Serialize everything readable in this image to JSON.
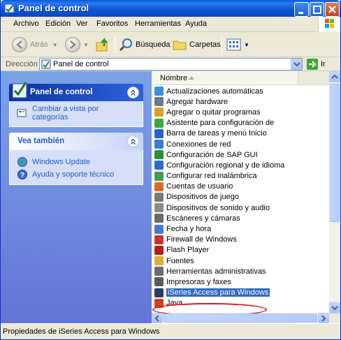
{
  "window": {
    "title": "Panel de control",
    "colors": {
      "titlebar": "#0b58d6",
      "taskpane": "#6f8ce0",
      "selection": "#316ac5",
      "highlight_ring": "#d11c1c"
    }
  },
  "menubar": {
    "items": [
      "Archivo",
      "Edición",
      "Ver",
      "Favoritos",
      "Herramientas",
      "Ayuda"
    ]
  },
  "toolbar": {
    "back_label": "Atrás",
    "search_label": "Búsqueda",
    "folders_label": "Carpetas"
  },
  "address": {
    "label": "Dirección",
    "value": "Panel de control",
    "go_label": "Ir"
  },
  "taskpane": {
    "control_panel": {
      "title": "Panel de control",
      "link": "Cambiar a vista por categorías"
    },
    "see_also": {
      "title": "Vea también",
      "links": [
        "Windows Update",
        "Ayuda y soporte técnico"
      ]
    }
  },
  "list": {
    "column_header": "Nombre",
    "items": [
      {
        "label": "Actualizaciones automáticas",
        "icon": "globe-icon"
      },
      {
        "label": "Agregar hardware",
        "icon": "hardware-icon"
      },
      {
        "label": "Agregar o quitar programas",
        "icon": "programs-icon"
      },
      {
        "label": "Asistente para configuración de",
        "icon": "wizard-icon"
      },
      {
        "label": "Barra de tareas y menú Inicio",
        "icon": "taskbar-icon"
      },
      {
        "label": "Conexiones de red",
        "icon": "network-icon"
      },
      {
        "label": "Configuración de SAP GUI",
        "icon": "sap-icon"
      },
      {
        "label": "Configuración regional y de idioma",
        "icon": "regional-icon"
      },
      {
        "label": "Configurar red inalámbrica",
        "icon": "wireless-icon"
      },
      {
        "label": "Cuentas de usuario",
        "icon": "users-icon"
      },
      {
        "label": "Dispositivos de juego",
        "icon": "gamepad-icon"
      },
      {
        "label": "Dispositivos de sonido y audio",
        "icon": "sound-icon"
      },
      {
        "label": "Escáneres y cámaras",
        "icon": "scanner-icon"
      },
      {
        "label": "Fecha y hora",
        "icon": "clock-icon"
      },
      {
        "label": "Firewall de Windows",
        "icon": "firewall-icon"
      },
      {
        "label": "Flash Player",
        "icon": "flash-icon"
      },
      {
        "label": "Fuentes",
        "icon": "fonts-icon"
      },
      {
        "label": "Herramientas administrativas",
        "icon": "admin-tools-icon"
      },
      {
        "label": "Impresoras y faxes",
        "icon": "printer-icon"
      },
      {
        "label": "iSeries Access para Windows",
        "icon": "iseries-icon",
        "selected": true
      },
      {
        "label": "Java",
        "icon": "java-icon"
      }
    ]
  },
  "statusbar": {
    "text": "Propiedades de iSeries Access para Windows"
  }
}
